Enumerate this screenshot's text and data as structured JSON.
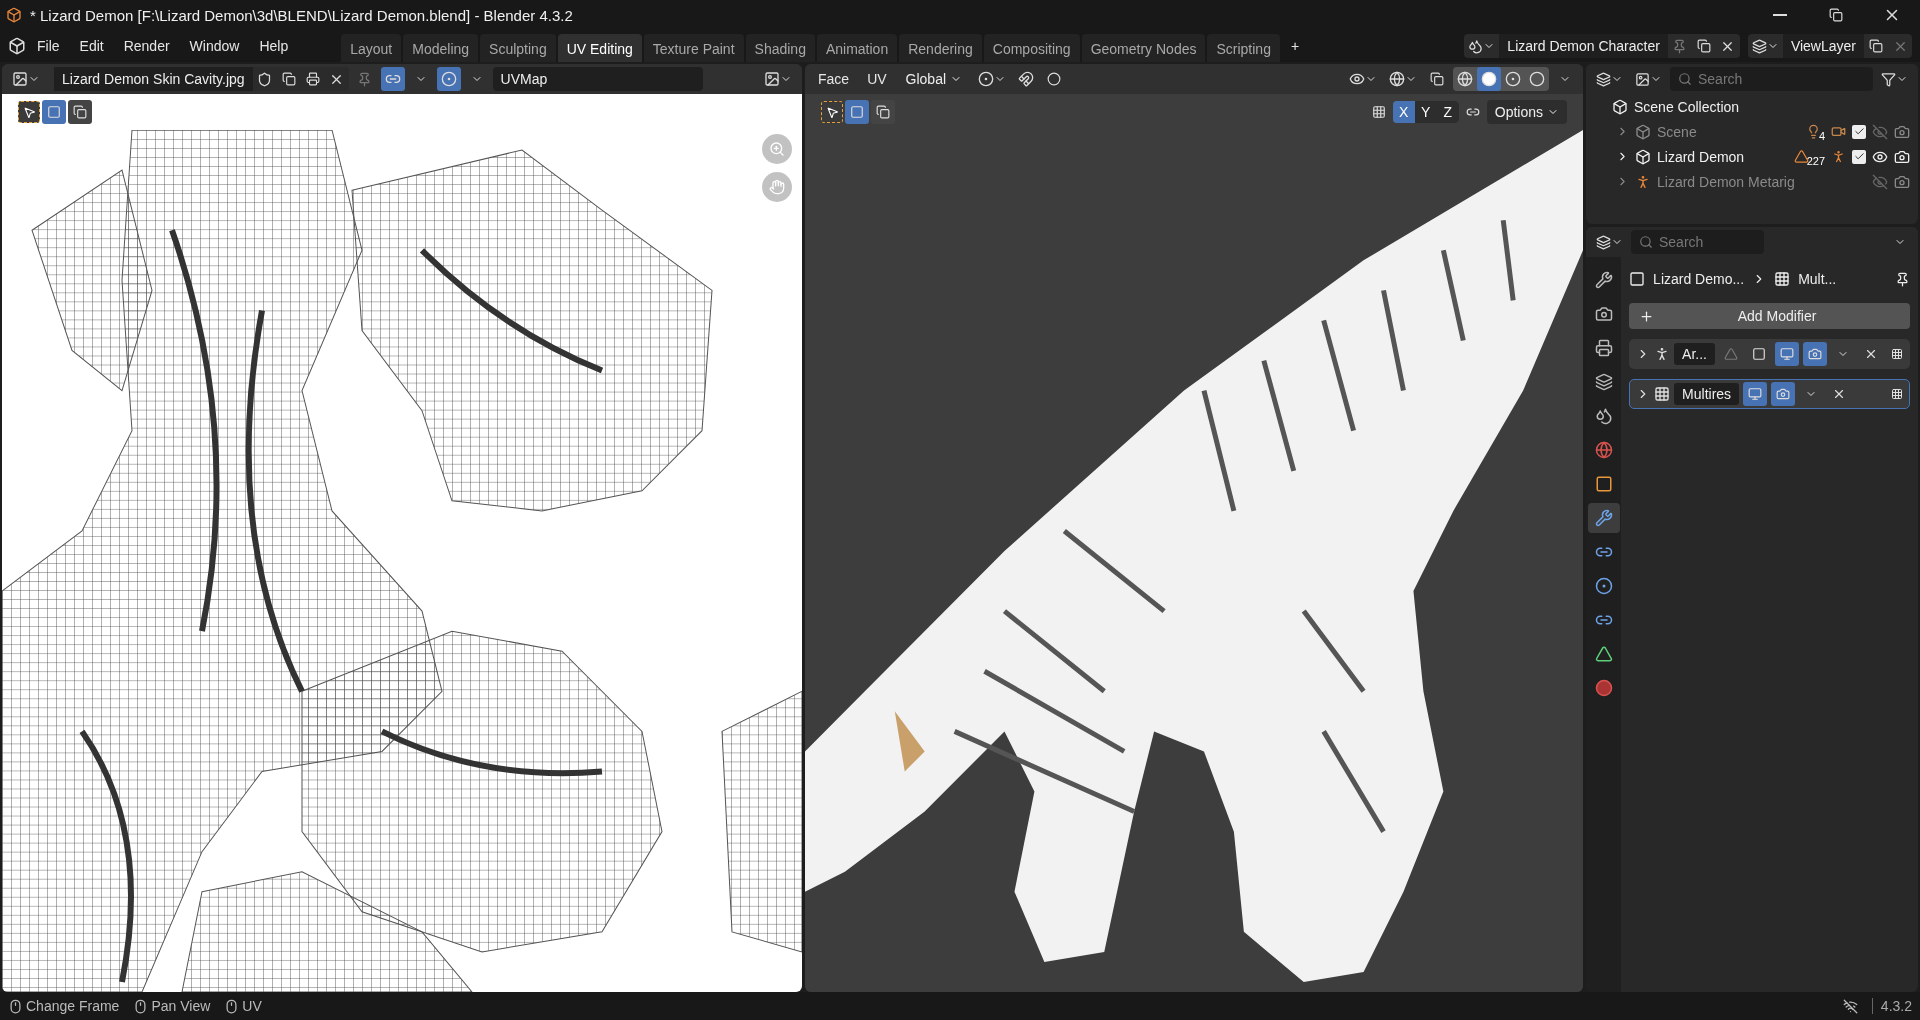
{
  "window": {
    "title": "* Lizard Demon [F:\\Lizard Demon\\3d\\BLEND\\Lizard Demon.blend] - Blender 4.3.2"
  },
  "menu": [
    "File",
    "Edit",
    "Render",
    "Window",
    "Help"
  ],
  "workspaces": [
    {
      "label": "Layout",
      "selected": false
    },
    {
      "label": "Modeling",
      "selected": false
    },
    {
      "label": "Sculpting",
      "selected": false
    },
    {
      "label": "UV Editing",
      "selected": true
    },
    {
      "label": "Texture Paint",
      "selected": false
    },
    {
      "label": "Shading",
      "selected": false
    },
    {
      "label": "Animation",
      "selected": false
    },
    {
      "label": "Rendering",
      "selected": false
    },
    {
      "label": "Compositing",
      "selected": false
    },
    {
      "label": "Geometry Nodes",
      "selected": false
    },
    {
      "label": "Scripting",
      "selected": false
    }
  ],
  "new_workspace": "+",
  "scene": {
    "name": "Lizard Demon Character"
  },
  "view_layer": {
    "name": "ViewLayer"
  },
  "uv_editor": {
    "image_name": "Lizard Demon Skin Cavity.jpg",
    "uv_map": "UVMap"
  },
  "viewport": {
    "menus": [
      "Face",
      "UV"
    ],
    "orientation": "Global",
    "axes": [
      {
        "label": "X",
        "selected": true
      },
      {
        "label": "Y",
        "selected": false
      },
      {
        "label": "Z",
        "selected": false
      }
    ],
    "shading": [
      {
        "kind": "wireframe",
        "selected": false
      },
      {
        "kind": "solid",
        "selected": true
      },
      {
        "kind": "material",
        "selected": false
      },
      {
        "kind": "rendered",
        "selected": false
      }
    ],
    "options": "Options"
  },
  "outliner": {
    "search_placeholder": "Search",
    "root": "Scene Collection",
    "items": [
      {
        "name": "Scene",
        "kind": "collection",
        "dimmed": true,
        "badge": "4",
        "checked": true,
        "visible": false
      },
      {
        "name": "Lizard Demon",
        "kind": "collection",
        "dimmed": false,
        "badge": "227",
        "checked": true,
        "visible": true
      },
      {
        "name": "Lizard Demon Metarig",
        "kind": "armature",
        "dimmed": true,
        "visible": false
      }
    ]
  },
  "properties": {
    "search_placeholder": "Search",
    "tabs": [
      {
        "kind": "tool",
        "selected": false
      },
      {
        "kind": "render",
        "selected": false
      },
      {
        "kind": "output",
        "selected": false
      },
      {
        "kind": "view_layer",
        "selected": false
      },
      {
        "kind": "scene",
        "selected": false
      },
      {
        "kind": "world",
        "selected": false
      },
      {
        "kind": "object",
        "selected": false
      },
      {
        "kind": "modifier",
        "selected": true
      },
      {
        "kind": "particles",
        "selected": false
      },
      {
        "kind": "physics",
        "selected": false
      },
      {
        "kind": "constraints",
        "selected": false
      },
      {
        "kind": "data",
        "selected": false
      },
      {
        "kind": "material",
        "selected": false
      }
    ],
    "breadcrumb": [
      "Lizard Demo...",
      "Mult..."
    ],
    "add_modifier": "Add Modifier",
    "modifiers": [
      {
        "name": "Ar...",
        "kind": "armature",
        "selected": false,
        "expanded": false
      },
      {
        "name": "Multires",
        "kind": "multires",
        "selected": true,
        "expanded": false
      }
    ]
  },
  "status_bar": {
    "hints": [
      "Change Frame",
      "Pan View",
      "UV"
    ],
    "version": "4.3.2"
  }
}
